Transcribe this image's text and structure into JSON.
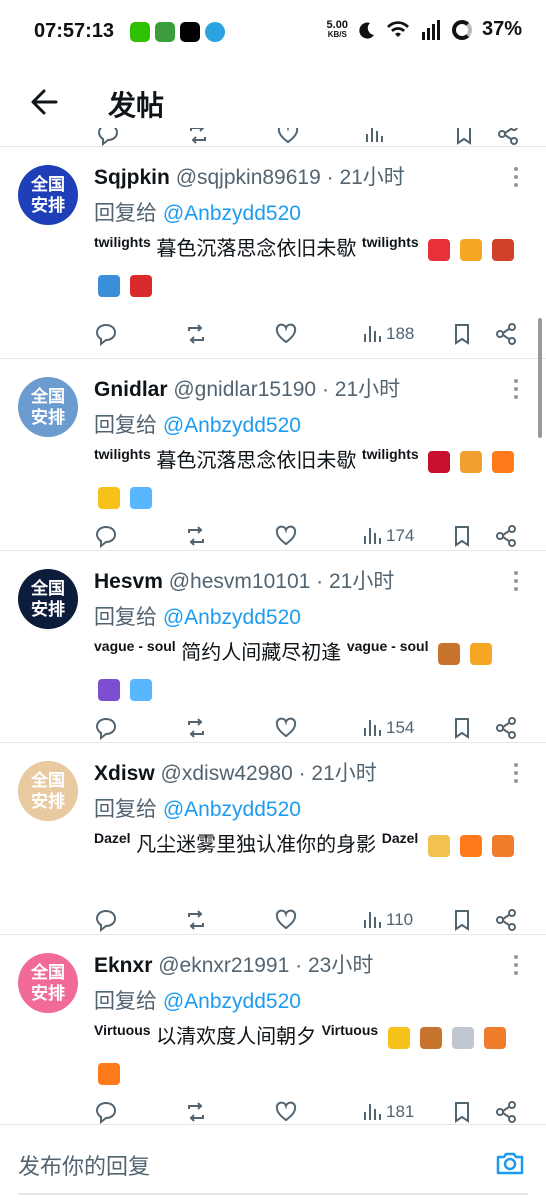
{
  "status_bar": {
    "time": "07:57:13",
    "network_speed_value": "5.00",
    "network_speed_unit": "KB/S",
    "battery": "37%",
    "notification_icons": [
      "wechat-icon",
      "game-icon",
      "x-icon",
      "telegram-icon"
    ]
  },
  "header": {
    "title": "发帖"
  },
  "colors": {
    "accent": "#1d9bf0",
    "muted": "#536471",
    "text": "#0f1419"
  },
  "posts": [
    {
      "avatar_text": "全国安排",
      "avatar_color": "#1e3fb8",
      "name": "Sqjpkin",
      "handle": "@sqjpkin89619",
      "time": "· 21小时",
      "reply_prefix": "回复给 ",
      "reply_mention": "@Anbzydd520",
      "deco_left": "twilights",
      "text": "暮色沉落思念依旧未歇",
      "deco_right": "twilights",
      "emojis": [
        "balloon-emoji",
        "rainbow-emoji",
        "mushroom-emoji",
        "luggage-emoji",
        "flag-emoji"
      ],
      "views": "188"
    },
    {
      "avatar_text": "全国安排",
      "avatar_color": "#6b9bcf",
      "name": "Gnidlar",
      "handle": "@gnidlar15190",
      "time": "· 21小时",
      "reply_prefix": "回复给 ",
      "reply_mention": "@Anbzydd520",
      "deco_left": "twilights",
      "text": "暮色沉落思念依旧未歇",
      "deco_right": "twilights",
      "emojis": [
        "rose-emoji",
        "gift-emoji",
        "fire-emoji",
        "sunflower-emoji",
        "gem-emoji"
      ],
      "views": "174"
    },
    {
      "avatar_text": "全国安排",
      "avatar_color": "#0b1d3a",
      "name": "Hesvm",
      "handle": "@hesvm10101",
      "time": "· 21小时",
      "reply_prefix": "回复给 ",
      "reply_mention": "@Anbzydd520",
      "deco_left": "vague - soul",
      "text": "简约人间藏尽初逢",
      "deco_right": "vague - soul",
      "emojis": [
        "fallen-leaf-emoji",
        "rainbow-emoji",
        "umbrella-emoji",
        "gem-emoji"
      ],
      "views": "154"
    },
    {
      "avatar_text": "全国安排",
      "avatar_color": "#e8c9a0",
      "name": "Xdisw",
      "handle": "@xdisw42980",
      "time": "· 21小时",
      "reply_prefix": "回复给 ",
      "reply_mention": "@Anbzydd520",
      "deco_left": "Dazel",
      "text": "凡尘迷雾里独认准你的身影",
      "deco_right": "Dazel",
      "emojis": [
        "thumbs-up-emoji",
        "fire-emoji",
        "party-popper-emoji"
      ],
      "views": "110"
    },
    {
      "avatar_text": "全国安排",
      "avatar_color": "#f06a9a",
      "name": "Eknxr",
      "handle": "@eknxr21991",
      "time": "· 23小时",
      "reply_prefix": "回复给 ",
      "reply_mention": "@Anbzydd520",
      "deco_left": "Virtuous",
      "text": "以清欢度人间朝夕",
      "deco_right": "Virtuous",
      "emojis": [
        "sunflower-emoji",
        "fallen-leaf-emoji",
        "rocket-emoji",
        "party-popper-emoji",
        "fire-emoji"
      ],
      "views": "181"
    }
  ],
  "reply_bar": {
    "placeholder": "发布你的回复"
  }
}
